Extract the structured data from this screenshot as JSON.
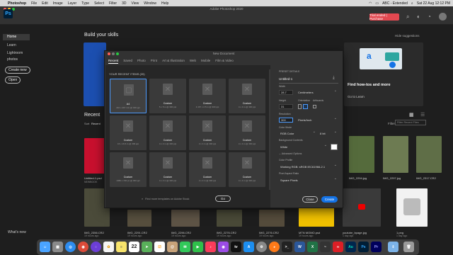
{
  "menubar": {
    "app": "Photoshop",
    "items": [
      "File",
      "Edit",
      "Image",
      "Layer",
      "Type",
      "Select",
      "Filter",
      "3D",
      "View",
      "Window",
      "Help"
    ],
    "status_text": "ABC - Extended",
    "clock": "Sat 22 Aug  12:12 PM"
  },
  "window": {
    "title": "Adobe Photoshop 2020",
    "trial_button": "Trial ended | Purchase",
    "logo": "Ps"
  },
  "sidebar": {
    "items": [
      "Home",
      "Learn",
      "Lightroom photos"
    ],
    "buttons": [
      "Create new",
      "Open"
    ],
    "footer": "What's new"
  },
  "home": {
    "build_skills": "Build your skills",
    "hide_suggestions": "Hide suggestions",
    "howto_title": "Find how-tos and more",
    "howto_link": "Go to Learn",
    "recent_title": "Recent",
    "sort_label": "Sort",
    "sort_value": "Recent",
    "filter_label": "Filter",
    "filter_placeholder": "Filter Recent Files",
    "recent_files": [
      {
        "name": "Untitled-1.psd",
        "sub": "NEWBOOK"
      },
      {
        "name": "IMG_2294.jpg",
        "sub": ""
      },
      {
        "name": "IMG_2297.jpg",
        "sub": ""
      },
      {
        "name": "IMG_2317.CR2",
        "sub": ""
      }
    ],
    "bottom_files": [
      {
        "name": "IMG_2356.CR2",
        "sub": "19 hours ago"
      },
      {
        "name": "IMG_2291.CR2",
        "sub": "19 hours ago"
      },
      {
        "name": "IMG_2296.CR2",
        "sub": "19 hours ago"
      },
      {
        "name": "IMG_2276.CR2",
        "sub": "19 hours ago"
      },
      {
        "name": "IMG_2276.CR2",
        "sub": "19 hours ago"
      },
      {
        "name": "MTN MOMO.psd",
        "sub": "19 hours ago"
      },
      {
        "name": "youtube_bpage.jpg",
        "sub": "1 day ago"
      },
      {
        "name": "1.png",
        "sub": "1 day ago"
      }
    ]
  },
  "dialog": {
    "title": "New Document",
    "tabs": [
      "Recent",
      "Saved",
      "Photo",
      "Print",
      "Art & Illustration",
      "Web",
      "Mobile",
      "Film & Video"
    ],
    "active_tab": "Recent",
    "recent_items_title": "YOUR RECENT ITEMS (20)",
    "presets": [
      {
        "name": "A4",
        "size": "210 x 297 mm @ 300 ppi"
      },
      {
        "name": "Custom",
        "size": "5 x 5 in @ 300 ppi"
      },
      {
        "name": "Custom",
        "size": "4.167 x 2.5 in @ 300 ppi"
      },
      {
        "name": "Custom",
        "size": "4 x 4 in @ 300 ppi"
      },
      {
        "name": "Custom",
        "size": "16 x 19.6 in @ 300 ppi"
      },
      {
        "name": "Custom",
        "size": "4 x 4 in @ 300 ppi"
      },
      {
        "name": "Custom",
        "size": "4 x 4 in @ 300 ppi"
      },
      {
        "name": "Custom",
        "size": "4 x 4 in @ 300 ppi"
      },
      {
        "name": "Custom",
        "size": "1080 x 720 px @ 300 ppi"
      },
      {
        "name": "Custom",
        "size": "4 x 4 in @ 300 ppi"
      },
      {
        "name": "Custom",
        "size": "4 x 4 in @ 300 ppi"
      },
      {
        "name": "Custom",
        "size": "4 x 4 in @ 300 ppi"
      }
    ],
    "search_placeholder": "Find more templates on Adobe Stock",
    "go_button": "Go",
    "details": {
      "heading": "PRESET DETAILS",
      "name": "Untitled-1",
      "width_label": "Width",
      "width_value": "28.7",
      "width_unit": "Centimeters",
      "height_label": "Height",
      "height_value": "31",
      "orientation_label": "Orientation",
      "artboards_label": "Artboards",
      "resolution_label": "Resolution",
      "resolution_value": "300",
      "resolution_unit": "Pixels/Inch",
      "color_mode_label": "Color Mode",
      "color_mode_value": "RGB Color",
      "bit_depth": "8 bit",
      "background_label": "Background Contents",
      "background_value": "White",
      "advanced_label": "Advanced Options",
      "profile_label": "Color Profile",
      "profile_value": "Working RGB: sRGB IEC61966-2.1",
      "aspect_label": "Pixel Aspect Ratio",
      "aspect_value": "Square Pixels"
    },
    "close_button": "Close",
    "create_button": "Create"
  },
  "dock": {
    "items": [
      "Finder",
      "Launchpad",
      "Safari",
      "Chrome",
      "Siri",
      "Photos",
      "Notes",
      "Calendar",
      "Maps",
      "Reminders",
      "Contacts",
      "Messages",
      "FaceTime",
      "Music",
      "Podcasts",
      "TV",
      "App Store",
      "System Preferences",
      "Firefox",
      "Terminal",
      "Word",
      "Excel",
      "Activity Monitor",
      "Creative Cloud",
      "Audition",
      "Photoshop",
      "Premiere Pro",
      "Downloads",
      "Trash"
    ],
    "calendar_day": "22"
  },
  "colors": {
    "accent": "#1473e6",
    "trial_red": "#e34850",
    "ps_blue": "#31a8ff",
    "selection": "#4c9bff"
  }
}
